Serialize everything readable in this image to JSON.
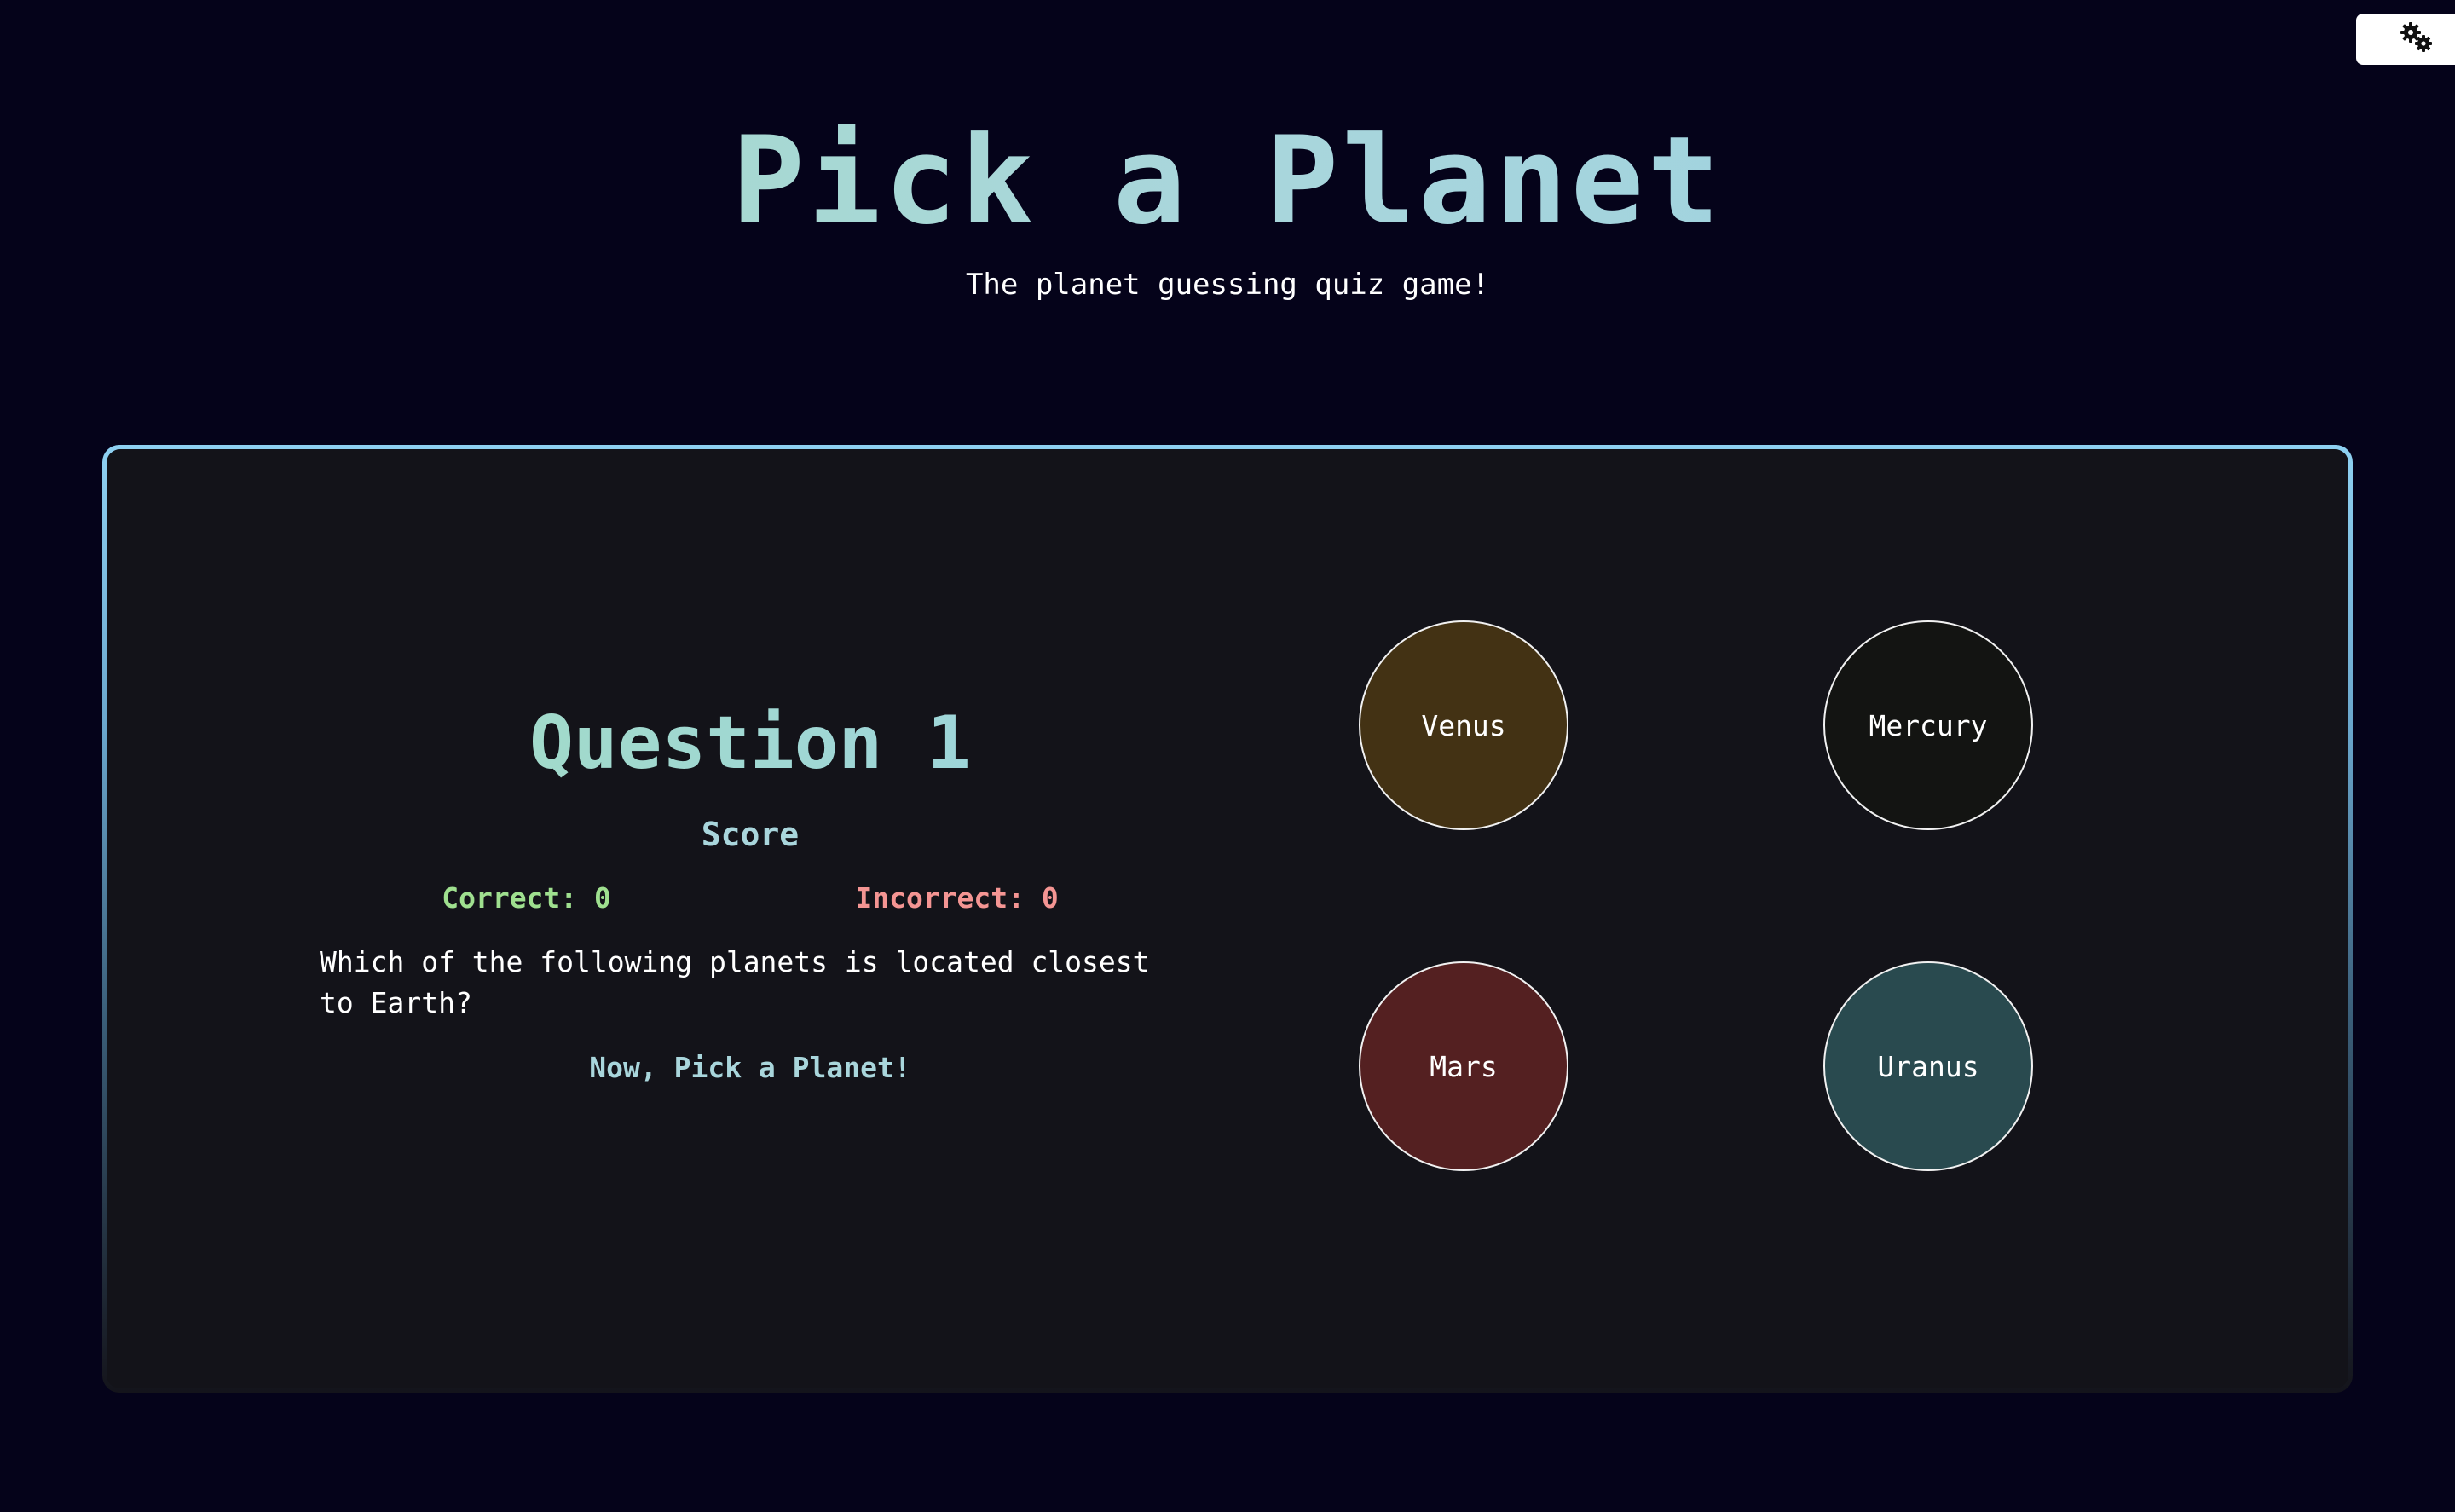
{
  "header": {
    "title": "Pick a Planet",
    "subtitle": "The planet guessing quiz game!"
  },
  "settings": {
    "icon": "gears-icon"
  },
  "quiz": {
    "question_title": "Question 1",
    "score_heading": "Score",
    "correct_label": "Correct: 0",
    "incorrect_label": "Incorrect: 0",
    "question_text": "Which of the following planets is located closest to Earth?",
    "prompt": "Now, Pick a Planet!"
  },
  "planets": [
    {
      "name": "Venus",
      "color": "#433214"
    },
    {
      "name": "Mercury",
      "color": "#131412"
    },
    {
      "name": "Mars",
      "color": "#542021"
    },
    {
      "name": "Uranus",
      "color": "#294a4f"
    }
  ],
  "colors": {
    "background": "#05031a",
    "panel": "#131319",
    "accent": "#a9d6dc",
    "correct": "#9fe08f",
    "incorrect": "#f49593"
  }
}
